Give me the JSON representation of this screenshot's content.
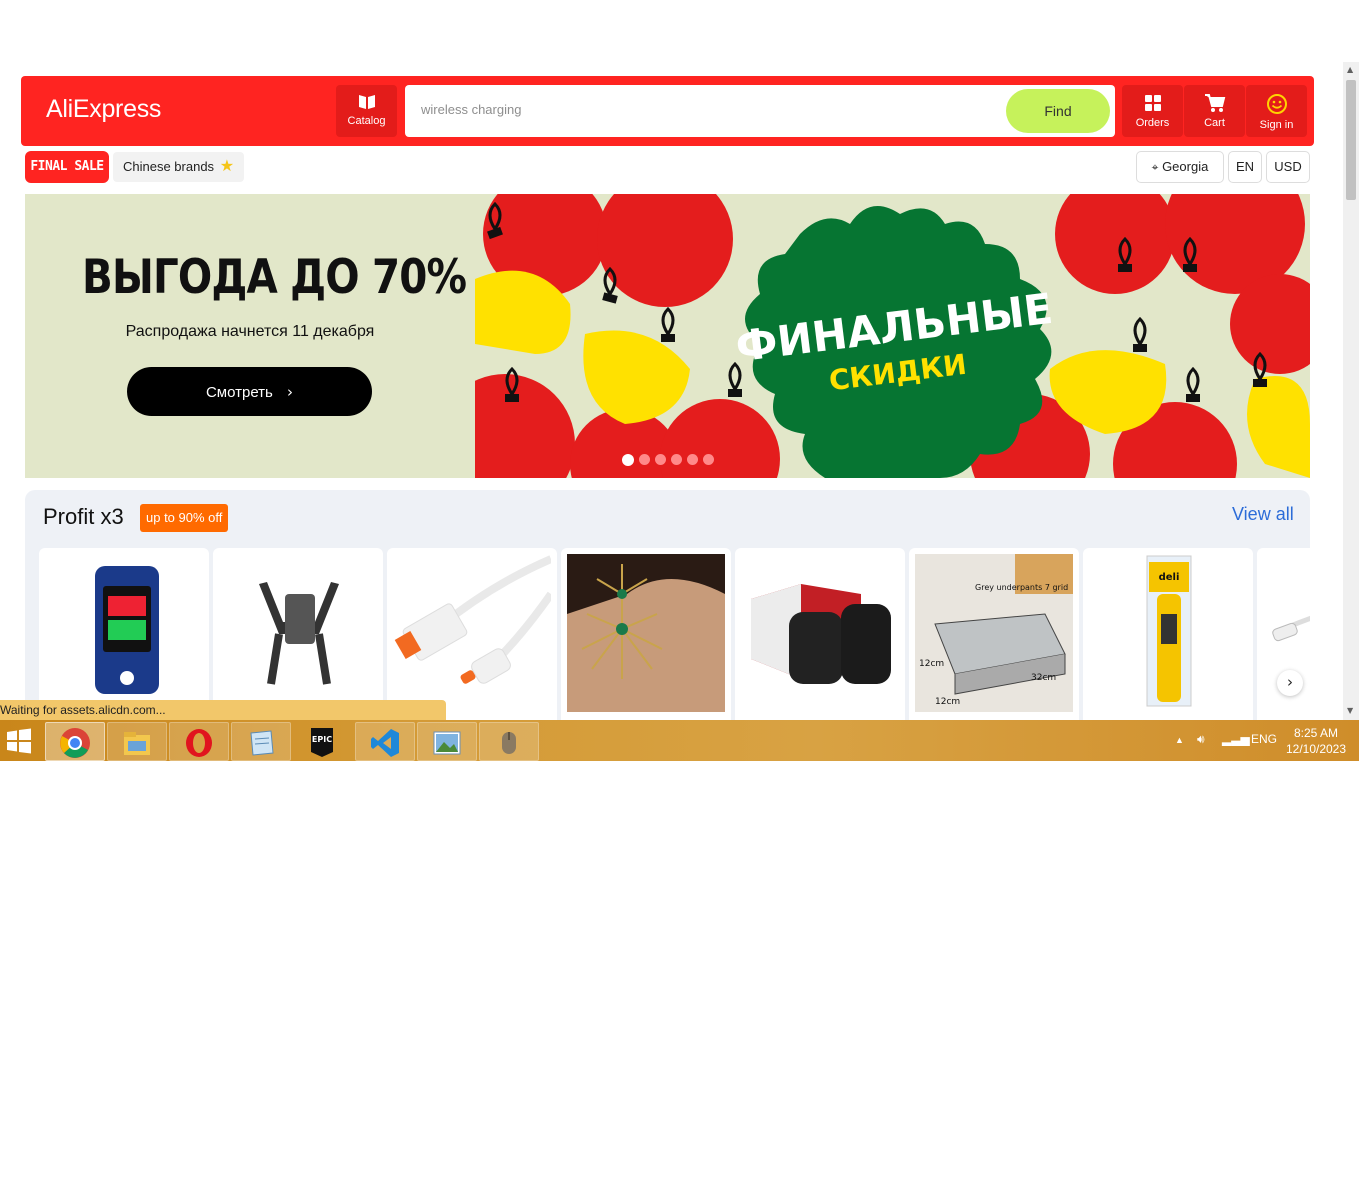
{
  "header": {
    "logo": "AliExpress",
    "catalog_label": "Catalog",
    "search_placeholder": "wireless charging",
    "find_label": "Find",
    "orders_label": "Orders",
    "cart_label": "Cart",
    "signin_label": "Sign in"
  },
  "subbar": {
    "final_sale": "FINAL SALE",
    "chinese_brands": "Chinese brands",
    "region": "Georgia",
    "language": "EN",
    "currency": "USD"
  },
  "banner": {
    "title": "ВЫГОДА ДО 70%",
    "subtitle": "Распродажа начнется 11 декабря",
    "button": "Смотреть",
    "art_title": "ФИНАЛЬНЫЕ",
    "art_subtitle": "СКИДКИ",
    "slide_count": 6,
    "active_slide": 1
  },
  "profit": {
    "title": "Profit x3",
    "badge": "up to 90% off",
    "view_all": "View all",
    "products": [
      {
        "icon": "pulse-oximeter-icon"
      },
      {
        "icon": "phone-car-holder-icon"
      },
      {
        "icon": "usb-c-cable-icon"
      },
      {
        "icon": "earring-icon"
      },
      {
        "icon": "wine-stopper-icon"
      },
      {
        "icon": "underwear-organizer-icon",
        "text": "Grey underpants 7 grid",
        "dims": [
          "12cm",
          "32cm",
          "12cm"
        ]
      },
      {
        "icon": "voltage-tester-pen-icon",
        "brand": "deli"
      },
      {
        "icon": "usb-c-cable-icon"
      }
    ]
  },
  "browser_status": "Waiting for assets.alicdn.com...",
  "taskbar": {
    "apps": [
      "start-icon",
      "chrome-icon",
      "file-explorer-icon",
      "opera-icon",
      "notepad-icon",
      "epic-games-icon",
      "vscode-icon",
      "photos-icon",
      "mouse-app-icon"
    ],
    "language": "ENG",
    "time": "8:25 AM",
    "date": "12/10/2023"
  },
  "colors": {
    "brand_red": "#ff2421",
    "find_green": "#c6f25b",
    "badge_orange": "#ff6a00",
    "link_blue": "#2c6cd8"
  }
}
